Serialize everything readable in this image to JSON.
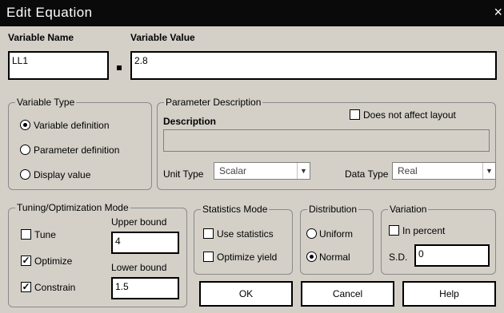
{
  "window": {
    "title": "Edit Equation",
    "close_glyph": "×"
  },
  "variable": {
    "name_label": "Variable Name",
    "value_label": "Variable Value",
    "name_value": "LL1",
    "value_value": "2.8"
  },
  "variable_type": {
    "legend": "Variable Type",
    "options": [
      "Variable definition",
      "Parameter definition",
      "Display value"
    ],
    "selected": 0
  },
  "parameter_description": {
    "legend": "Parameter Description",
    "description_label": "Description",
    "does_not_affect_layout": "Does not affect layout",
    "description_value": "",
    "unit_type_label": "Unit Type",
    "unit_type_value": "Scalar",
    "data_type_label": "Data Type",
    "data_type_value": "Real"
  },
  "tuning": {
    "legend": "Tuning/Optimization Mode",
    "tune_label": "Tune",
    "tune_checked": false,
    "optimize_label": "Optimize",
    "optimize_checked": true,
    "constrain_label": "Constrain",
    "constrain_checked": true,
    "upper_bound_label": "Upper bound",
    "upper_bound_value": "4",
    "lower_bound_label": "Lower bound",
    "lower_bound_value": "1.5"
  },
  "statistics": {
    "legend": "Statistics Mode",
    "use_statistics": "Use statistics",
    "optimize_yield": "Optimize yield"
  },
  "distribution": {
    "legend": "Distribution",
    "uniform": "Uniform",
    "normal": "Normal",
    "selected": "normal"
  },
  "variation": {
    "legend": "Variation",
    "in_percent": "In percent",
    "sd_label": "S.D.",
    "sd_value": "0"
  },
  "buttons": {
    "ok": "OK",
    "cancel": "Cancel",
    "help": "Help"
  }
}
